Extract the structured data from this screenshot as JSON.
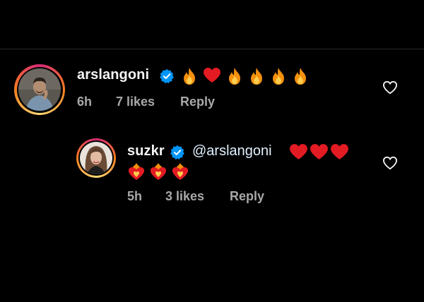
{
  "comments": [
    {
      "username": "arslangoni",
      "verified": true,
      "text_prefix": "",
      "emojis_line1": [
        "fire",
        "red-heart",
        "fire",
        "fire",
        "fire",
        "fire"
      ],
      "time": "6h",
      "likes": "7 likes",
      "reply_label": "Reply"
    },
    {
      "username": "suzkr",
      "verified": true,
      "mention": "@arslangoni",
      "emojis_line1": [
        "red-heart",
        "red-heart",
        "red-heart"
      ],
      "emojis_line2": [
        "heart-on-fire",
        "heart-on-fire",
        "heart-on-fire"
      ],
      "time": "5h",
      "likes": "3 likes",
      "reply_label": "Reply"
    }
  ],
  "colors": {
    "background": "#000000",
    "meta_text": "#a8a8a8",
    "verified_blue": "#0095f6",
    "story_ring": "#d62976"
  }
}
